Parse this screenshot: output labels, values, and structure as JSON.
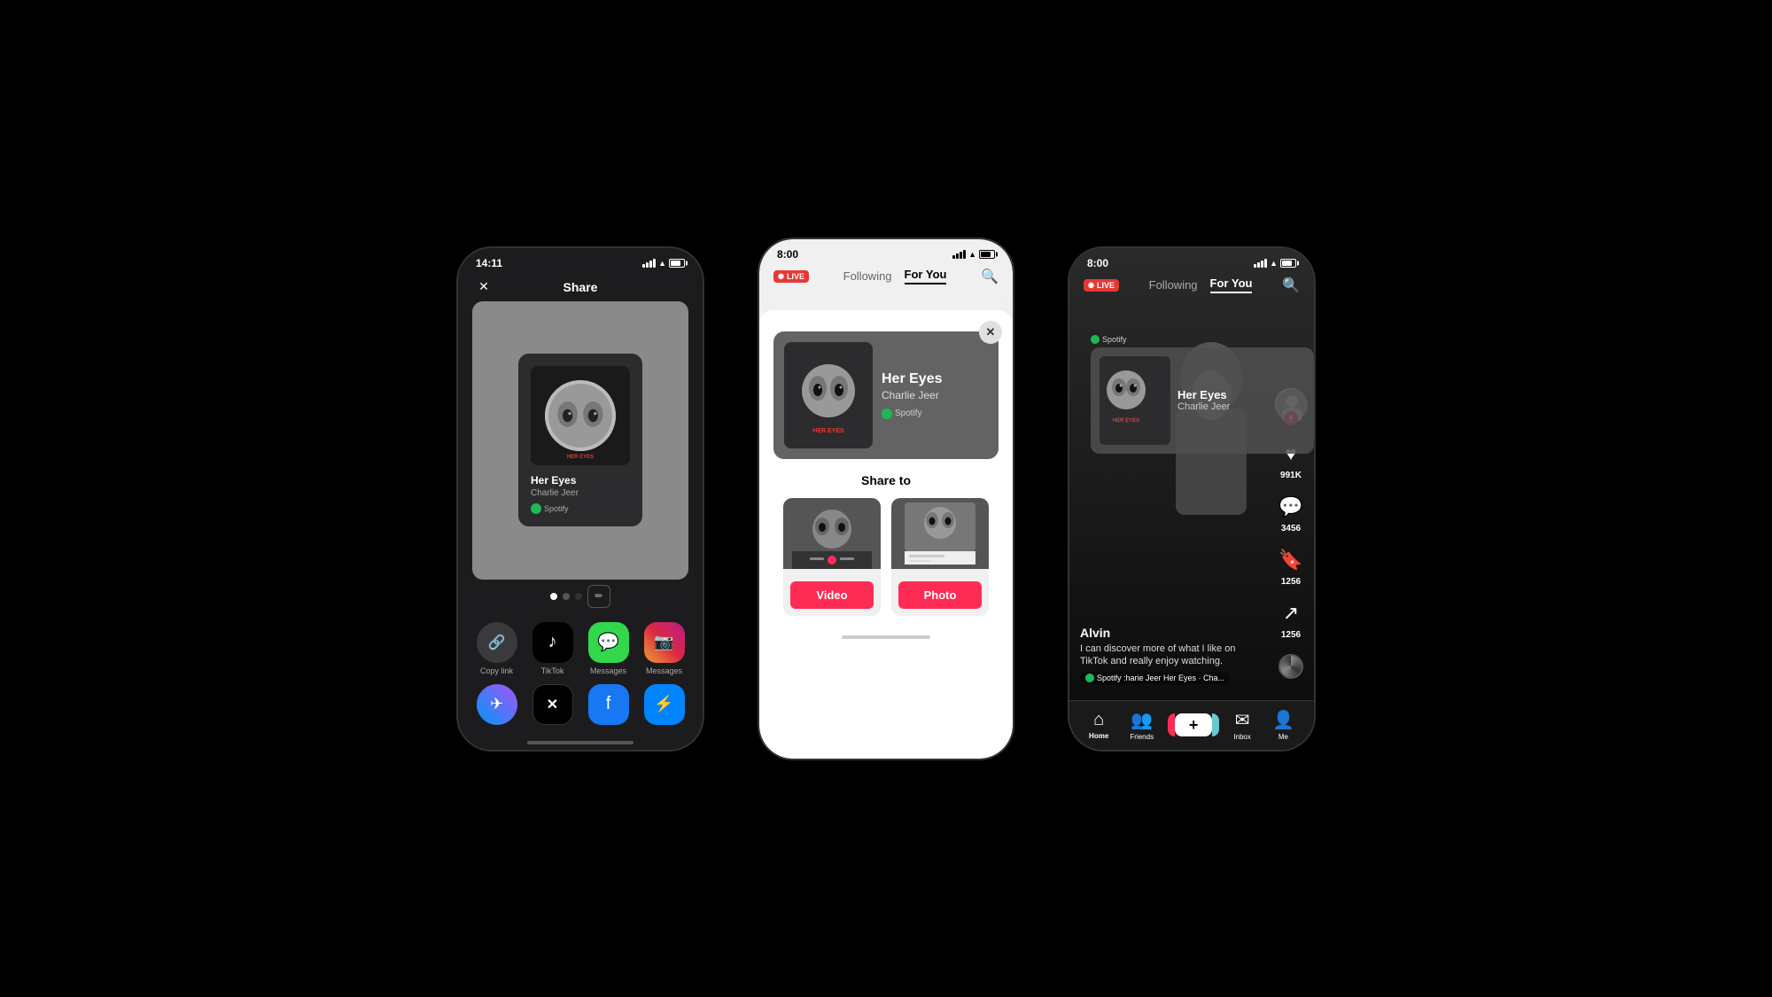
{
  "background": "#000000",
  "phone1": {
    "type": "share_sheet",
    "status_bar": {
      "time": "14:11",
      "signal": "▐▐▐",
      "wifi": "wifi",
      "battery": "80"
    },
    "header": {
      "close_label": "✕",
      "title": "Share"
    },
    "music_card": {
      "title": "Her Eyes",
      "artist": "Charlie Jeer",
      "platform": "Spotify"
    },
    "dots": [
      "active",
      "filled",
      "dark"
    ],
    "apps_row1": [
      {
        "label": "Copy link",
        "type": "copy"
      },
      {
        "label": "TikTok",
        "type": "tiktok"
      },
      {
        "label": "Messages",
        "type": "messages"
      },
      {
        "label": "Messages",
        "type": "instagram"
      }
    ],
    "apps_row2": [
      {
        "label": "",
        "type": "messenger"
      },
      {
        "label": "",
        "type": "x"
      },
      {
        "label": "",
        "type": "facebook"
      },
      {
        "label": "",
        "type": "facebook_msg"
      }
    ]
  },
  "phone2": {
    "type": "share_to",
    "status_bar": {
      "time": "8:00",
      "signal": "▐▐▐",
      "wifi": "wifi",
      "battery": "80"
    },
    "nav": {
      "live_label": "LIVE",
      "tabs": [
        "Following",
        "For You"
      ],
      "active_tab": "For You"
    },
    "modal": {
      "close_label": "✕",
      "music_card": {
        "title": "Her Eyes",
        "artist": "Charlie Jeer",
        "platform": "Spotify"
      },
      "share_to_label": "Share to",
      "options": [
        {
          "label": "Video",
          "type": "video"
        },
        {
          "label": "Photo",
          "type": "photo"
        }
      ]
    }
  },
  "phone3": {
    "type": "tiktok_feed",
    "status_bar": {
      "time": "8:00",
      "signal": "▐▐▐",
      "wifi": "wifi",
      "battery": "80"
    },
    "nav": {
      "live_label": "LIVE",
      "tabs": [
        "Following",
        "For You"
      ],
      "active_tab": "For You"
    },
    "music_card": {
      "title": "Her Eyes",
      "artist": "Charlie Jeer",
      "platform": "Spotify"
    },
    "feed": {
      "username": "Alvin",
      "description": "I can discover more of what I like on TikTok and really enjoy watching.",
      "music_info": "🎵 Spotify  :harie Jeer  Her Eyes · Cha..."
    },
    "actions": {
      "likes": "991K",
      "comments": "3456",
      "bookmarks": "1256",
      "shares": "1256"
    },
    "bottom_nav": [
      {
        "label": "Home",
        "icon": "🏠",
        "active": true
      },
      {
        "label": "Friends",
        "icon": "👥",
        "active": false
      },
      {
        "label": "",
        "icon": "+",
        "active": false
      },
      {
        "label": "Inbox",
        "icon": "✉",
        "active": false
      },
      {
        "label": "Me",
        "icon": "👤",
        "active": false
      }
    ]
  }
}
